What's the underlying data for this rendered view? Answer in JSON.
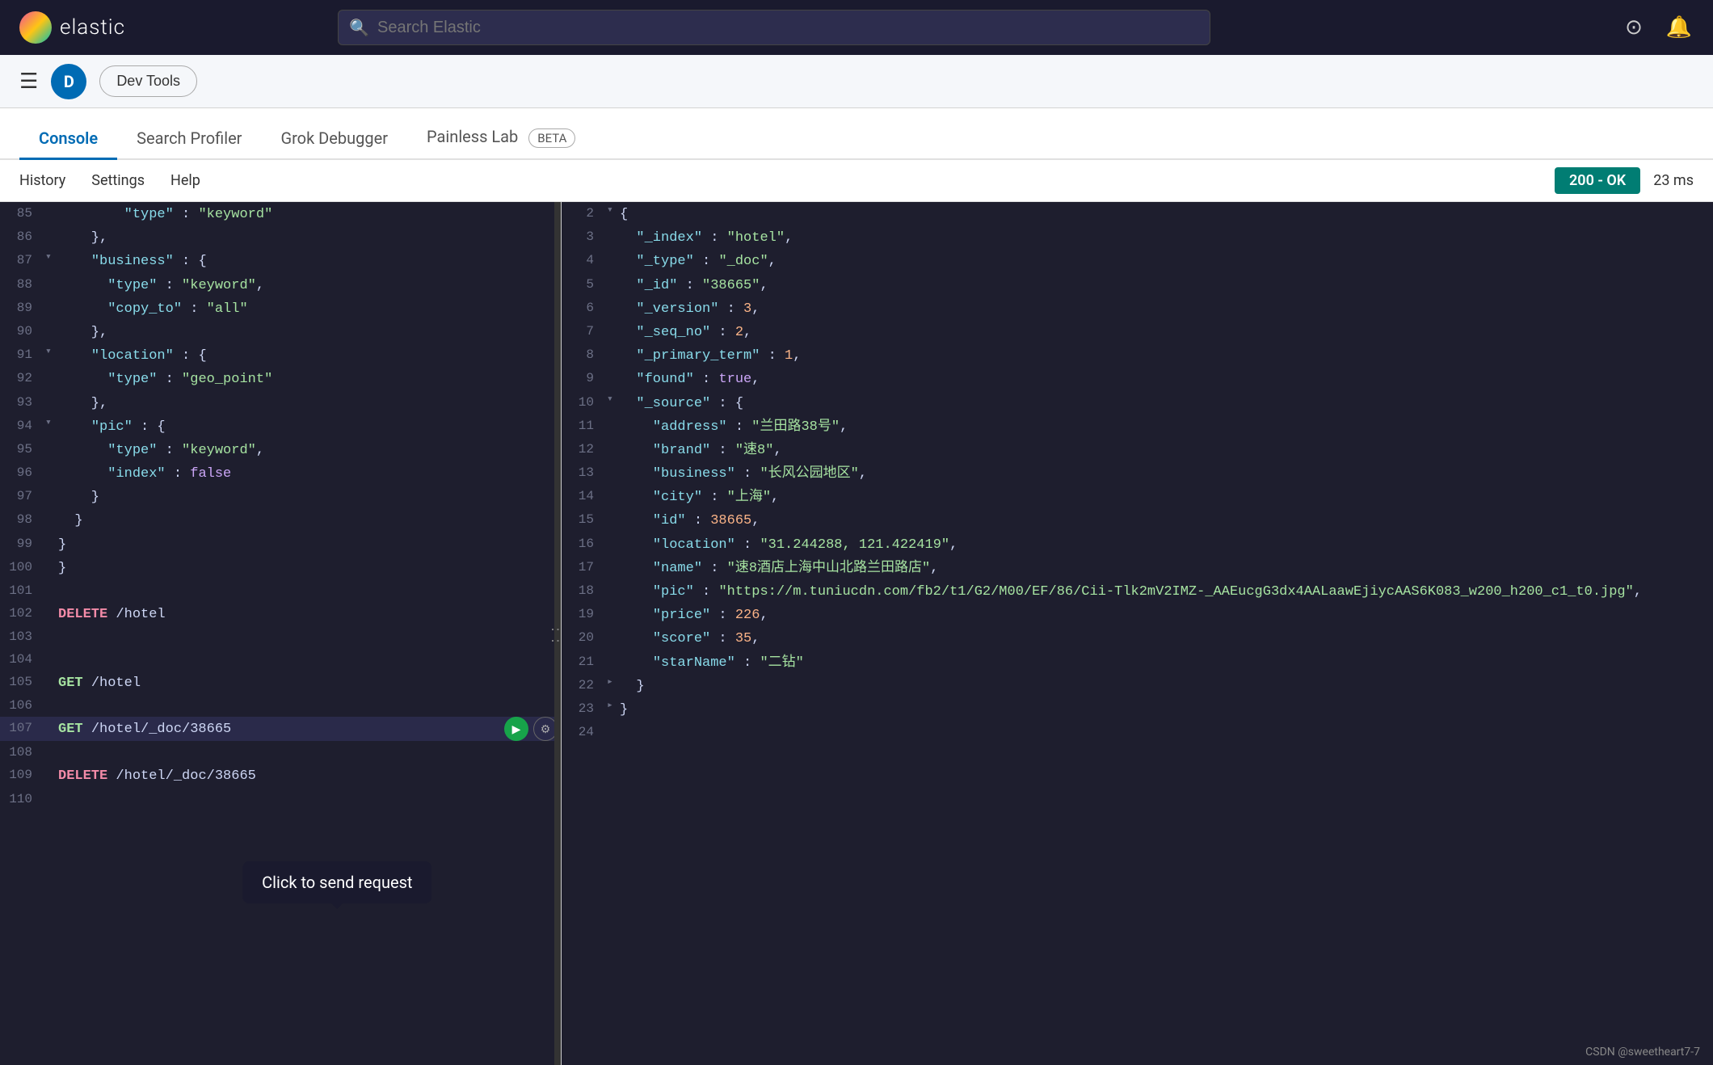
{
  "topbar": {
    "logo_text": "elastic",
    "search_placeholder": "Search Elastic",
    "search_value": ""
  },
  "second_bar": {
    "dev_tools_label": "Dev Tools"
  },
  "tabs": [
    {
      "id": "console",
      "label": "Console",
      "active": true
    },
    {
      "id": "search-profiler",
      "label": "Search Profiler",
      "active": false
    },
    {
      "id": "grok-debugger",
      "label": "Grok Debugger",
      "active": false
    },
    {
      "id": "painless-lab",
      "label": "Painless Lab",
      "active": false
    }
  ],
  "beta_label": "BETA",
  "sub_toolbar": {
    "items": [
      "History",
      "Settings",
      "Help"
    ],
    "status": "200 - OK",
    "time": "23 ms"
  },
  "tooltip": {
    "text": "Click to send request"
  },
  "left_lines": [
    {
      "num": "85",
      "fold": "",
      "content": "        \"type\": \"keyword\"",
      "key_color": true
    },
    {
      "num": "86",
      "fold": "",
      "content": "    },",
      "key_color": false
    },
    {
      "num": "87",
      "fold": "▾",
      "content": "    \"business\": {",
      "key_color": true
    },
    {
      "num": "88",
      "fold": "",
      "content": "      \"type\": \"keyword\",",
      "key_color": true
    },
    {
      "num": "89",
      "fold": "",
      "content": "      \"copy_to\": \"all\"",
      "key_color": true
    },
    {
      "num": "90",
      "fold": "",
      "content": "    },",
      "key_color": false
    },
    {
      "num": "91",
      "fold": "▾",
      "content": "    \"location\": {",
      "key_color": true
    },
    {
      "num": "92",
      "fold": "",
      "content": "      \"type\": \"geo_point\"",
      "key_color": true
    },
    {
      "num": "93",
      "fold": "",
      "content": "    },",
      "key_color": false
    },
    {
      "num": "94",
      "fold": "▾",
      "content": "    \"pic\": {",
      "key_color": true
    },
    {
      "num": "95",
      "fold": "",
      "content": "      \"type\": \"keyword\",",
      "key_color": true
    },
    {
      "num": "96",
      "fold": "",
      "content": "      \"index\": false",
      "key_color": true
    },
    {
      "num": "97",
      "fold": "",
      "content": "    }",
      "key_color": false
    },
    {
      "num": "98",
      "fold": "",
      "content": "  }",
      "key_color": false
    },
    {
      "num": "99",
      "fold": "",
      "content": "}",
      "key_color": false
    },
    {
      "num": "100",
      "fold": "",
      "content": "}",
      "key_color": false
    },
    {
      "num": "101",
      "fold": "",
      "content": "",
      "key_color": false
    },
    {
      "num": "102",
      "fold": "",
      "content": "DELETE /hotel",
      "method": "delete"
    },
    {
      "num": "103",
      "fold": "",
      "content": "",
      "key_color": false
    },
    {
      "num": "104",
      "fold": "",
      "content": "",
      "key_color": false
    },
    {
      "num": "105",
      "fold": "",
      "content": "GET /hotel",
      "method": "get"
    },
    {
      "num": "106",
      "fold": "",
      "content": "",
      "key_color": false
    },
    {
      "num": "107",
      "fold": "",
      "content": "GET /hotel/_doc/38665",
      "method": "get",
      "highlighted": true,
      "has_actions": true
    },
    {
      "num": "108",
      "fold": "",
      "content": "",
      "key_color": false
    },
    {
      "num": "109",
      "fold": "",
      "content": "DELETE /hotel/_doc/38665",
      "method": "delete"
    },
    {
      "num": "110",
      "fold": "",
      "content": "",
      "key_color": false
    }
  ],
  "right_lines": [
    {
      "num": "2",
      "fold": "▾",
      "content": "{"
    },
    {
      "num": "3",
      "fold": "",
      "content": "  \"_index\" : \"hotel\","
    },
    {
      "num": "4",
      "fold": "",
      "content": "  \"_type\" : \"_doc\","
    },
    {
      "num": "5",
      "fold": "",
      "content": "  \"_id\" : \"38665\","
    },
    {
      "num": "6",
      "fold": "",
      "content": "  \"_version\" : 3,"
    },
    {
      "num": "7",
      "fold": "",
      "content": "  \"_seq_no\" : 2,"
    },
    {
      "num": "8",
      "fold": "",
      "content": "  \"_primary_term\" : 1,"
    },
    {
      "num": "9",
      "fold": "",
      "content": "  \"found\" : true,"
    },
    {
      "num": "10",
      "fold": "▾",
      "content": "  \"_source\" : {"
    },
    {
      "num": "11",
      "fold": "",
      "content": "    \"address\" : \"兰田路38号\","
    },
    {
      "num": "12",
      "fold": "",
      "content": "    \"brand\" : \"速8\","
    },
    {
      "num": "13",
      "fold": "",
      "content": "    \"business\" : \"长风公园地区\","
    },
    {
      "num": "14",
      "fold": "",
      "content": "    \"city\" : \"上海\","
    },
    {
      "num": "15",
      "fold": "",
      "content": "    \"id\" : 38665,"
    },
    {
      "num": "16",
      "fold": "",
      "content": "    \"location\" : \"31.244288, 121.422419\","
    },
    {
      "num": "17",
      "fold": "",
      "content": "    \"name\" : \"速8酒店上海中山北路兰田路店\","
    },
    {
      "num": "18",
      "fold": "",
      "content": "    \"pic\" : \"https://m.tuniucdn.com/fb2/t1/G2/M00/EF/86/Cii-Tlk2mV2IMZ-_AAEucgG3dx4AALaawEjiycAAS6K083_w200_h200_c1_t0.jpg\","
    },
    {
      "num": "19",
      "fold": "",
      "content": "    \"price\" : 226,"
    },
    {
      "num": "20",
      "fold": "",
      "content": "    \"score\" : 35,"
    },
    {
      "num": "21",
      "fold": "",
      "content": "    \"starName\" : \"二钻\""
    },
    {
      "num": "22",
      "fold": "▸",
      "content": "  }"
    },
    {
      "num": "23",
      "fold": "▸",
      "content": "}"
    },
    {
      "num": "24",
      "fold": "",
      "content": ""
    }
  ],
  "credit": "CSDN @sweetheart7-7"
}
